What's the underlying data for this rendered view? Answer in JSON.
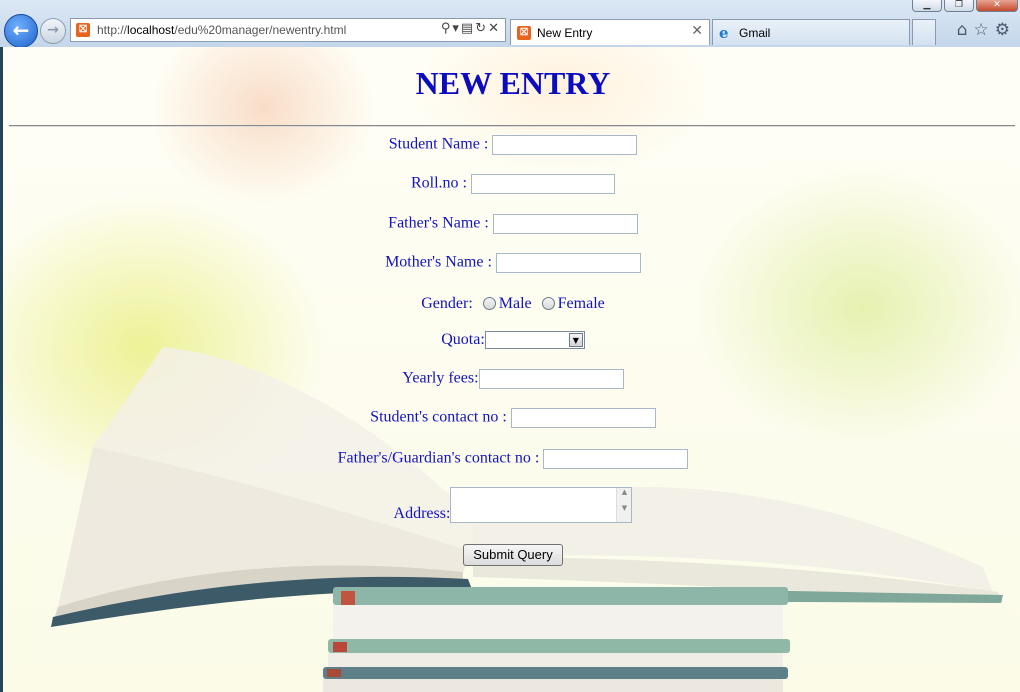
{
  "browser": {
    "url_prefix": "http://",
    "url_host": "localhost",
    "url_path": "/edu%20manager/newentry.html",
    "tabs": [
      {
        "label": "New Entry",
        "active": true
      },
      {
        "label": "Gmail",
        "active": false
      }
    ],
    "window_buttons": {
      "minimize": "▁",
      "maximize": "❐",
      "close": "✕"
    },
    "icons": {
      "back": "arrow-left-icon",
      "forward": "arrow-right-icon",
      "search": "search-icon",
      "compat": "compatibility-icon",
      "refresh": "refresh-icon",
      "stop": "stop-icon",
      "home": "home-icon",
      "favorites": "star-icon",
      "tools": "gear-icon"
    }
  },
  "form": {
    "title": "NEW ENTRY",
    "student_name_label": "Student Name :",
    "student_name_value": "",
    "roll_no_label": "Roll.no :",
    "roll_no_value": "",
    "father_name_label": "Father's Name :",
    "father_name_value": "",
    "mother_name_label": "Mother's Name :",
    "mother_name_value": "",
    "gender_label": "Gender:",
    "gender_options": [
      "Male",
      "Female"
    ],
    "quota_label": "Quota:",
    "quota_value": "",
    "yearly_fees_label": "Yearly fees:",
    "yearly_fees_value": "",
    "student_contact_label": "Student's contact no :",
    "student_contact_value": "",
    "guardian_contact_label": "Father's/Guardian's contact no :",
    "guardian_contact_value": "",
    "address_label": "Address:",
    "address_value": "",
    "submit_label": "Submit Query"
  },
  "colors": {
    "label": "#1313c0",
    "title": "#0b0bbf",
    "tab_favicon": "#e8641e"
  }
}
